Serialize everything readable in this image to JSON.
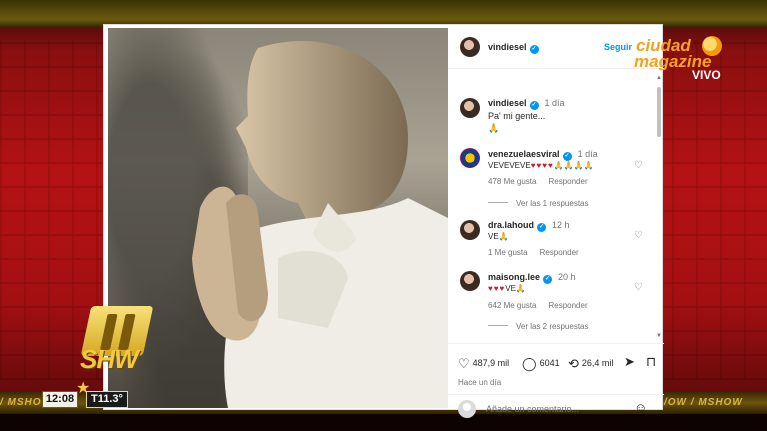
{
  "broadcast": {
    "logo_line1": "ciudad",
    "logo_line2": "magazine",
    "live_label": "VIVO",
    "ticker_left": "/ MSHOW",
    "ticker_right": "/OW / MSHOW",
    "time": "12:08",
    "temperature": "T11.3°",
    "show_logo_text": "SHW"
  },
  "post": {
    "author": "vindiesel",
    "follow_label": "Seguir",
    "caption": {
      "username": "vindiesel",
      "time": "1 día",
      "text": "Pa' mi gente...",
      "emoji": "🙏"
    },
    "comments": [
      {
        "username": "venezuelaesviral",
        "time": "1 día",
        "text_prefix": "VEVEVEVE",
        "hearts": "♥♥♥♥",
        "pray": "🙏🙏🙏🙏",
        "likes": "478 Me gusta",
        "reply_label": "Responder",
        "view_replies": "Ver las 1 respuestas"
      },
      {
        "username": "dra.lahoud",
        "time": "12 h",
        "text_prefix": "VE",
        "pray": "🙏",
        "likes": "1 Me gusta",
        "reply_label": "Responder"
      },
      {
        "username": "maisong.lee",
        "time": "20 h",
        "hearts": "♥♥♥",
        "text_suffix": "VE",
        "pray": "🙏",
        "likes": "642 Me gusta",
        "reply_label": "Responder",
        "view_replies": "Ver las 2 respuestas"
      }
    ],
    "stats": {
      "likes": "487,9 mil",
      "comments": "6041",
      "reposts": "26,4 mil"
    },
    "posted_ago": "Hace un día",
    "comment_placeholder": "Añade un comentario..."
  },
  "icons": {
    "heart": "heart-icon",
    "comment": "comment-icon",
    "repost": "repost-icon",
    "share": "share-icon",
    "bookmark": "bookmark-icon",
    "emoji": "emoji-icon"
  },
  "colors": {
    "instagram_blue": "#0095f6",
    "logo_orange": "#f7a21b",
    "heart_red": "#d4162c"
  }
}
